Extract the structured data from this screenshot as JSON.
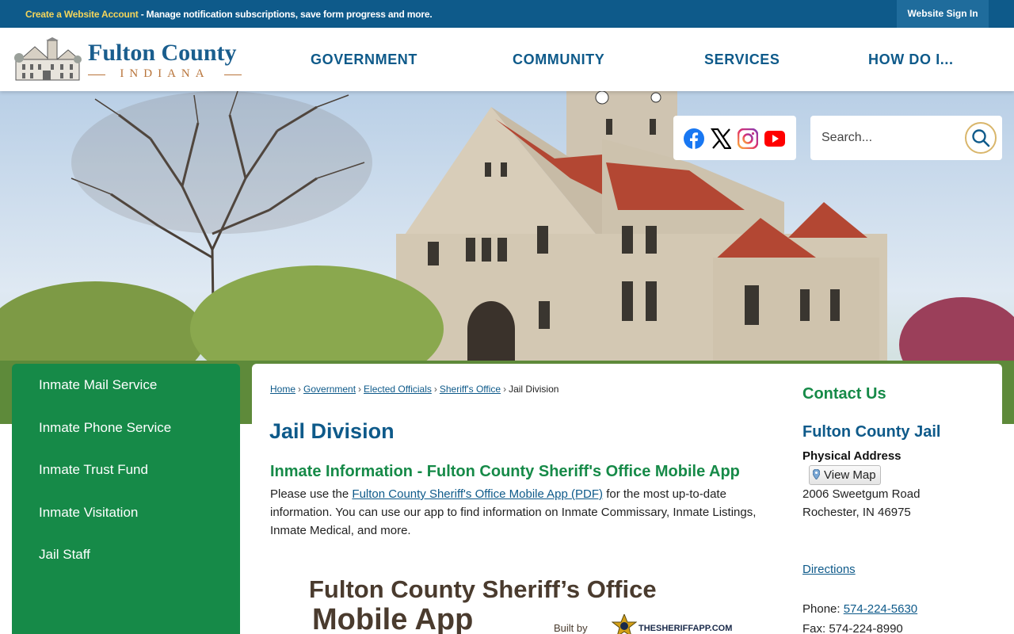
{
  "topbar": {
    "create_account": "Create a Website Account",
    "promo_text": " - Manage notification subscriptions, save form progress and more.",
    "sign_in": "Website Sign In"
  },
  "logo": {
    "name": "Fulton County",
    "subtitle": "INDIANA"
  },
  "nav": {
    "items": [
      "GOVERNMENT",
      "COMMUNITY",
      "SERVICES",
      "HOW DO I..."
    ]
  },
  "social": {
    "icons": [
      "facebook-icon",
      "x-icon",
      "instagram-icon",
      "youtube-icon"
    ],
    "colors": {
      "facebook": "#1877f2",
      "x": "#000000",
      "youtube": "#ff0000"
    }
  },
  "search": {
    "placeholder": "Search..."
  },
  "sidebar": {
    "items": [
      {
        "label": "Inmate Mail Service"
      },
      {
        "label": "Inmate Phone Service"
      },
      {
        "label": "Inmate Trust Fund"
      },
      {
        "label": "Inmate Visitation"
      },
      {
        "label": "Jail Staff"
      }
    ]
  },
  "breadcrumb": {
    "items": [
      "Home",
      "Government",
      "Elected Officials",
      "Sheriff's Office"
    ],
    "current": "Jail Division"
  },
  "main": {
    "title": "Jail Division",
    "section_title": "Inmate Information - Fulton County Sheriff's Office Mobile App",
    "text_before": "Please use the ",
    "link_text": "Fulton County Sheriff's Office Mobile App (PDF)",
    "text_after": " for the most up-to-date information. You can use our app to find information on Inmate Commissary, Inmate Listings, Inmate Medical, and more.",
    "app_title": "Fulton County Sheriff’s Office",
    "app_subtitle": "Mobile App",
    "built_by": "Built by",
    "builder": "THESHERIFFAPP.COM"
  },
  "contact": {
    "heading": "Contact Us",
    "name": "Fulton County Jail",
    "address_label": "Physical Address",
    "view_map": "View Map",
    "street": "2006 Sweetgum Road",
    "city": "Rochester, IN 46975",
    "directions": "Directions",
    "phone_label": "Phone: ",
    "phone": "574-224-5630",
    "fax": "Fax: 574-224-8990"
  },
  "colors": {
    "brand_blue": "#0e5a8a",
    "brand_green": "#168a48",
    "accent_gold": "#f4d55b"
  }
}
